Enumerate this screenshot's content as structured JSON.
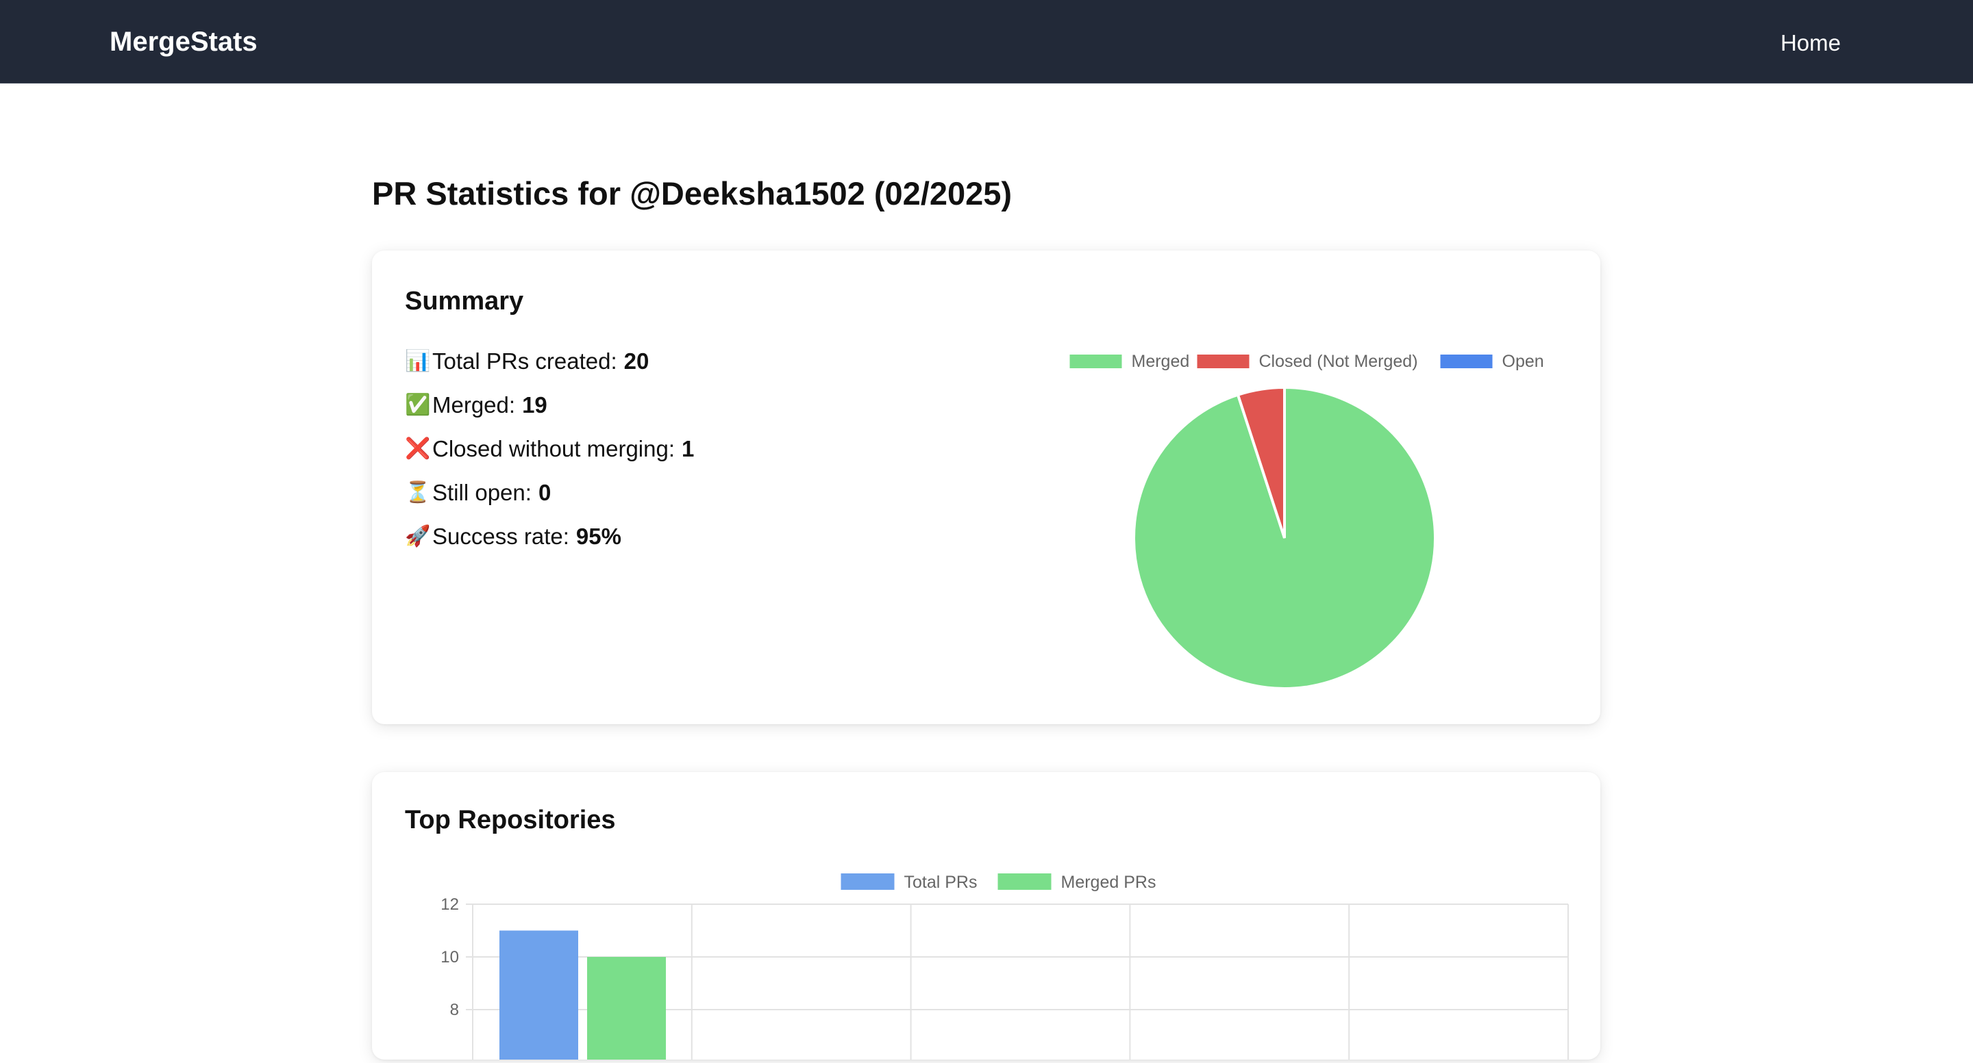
{
  "nav": {
    "brand": "MergeStats",
    "home": "Home"
  },
  "page": {
    "title": "PR Statistics for @Deeksha1502 (02/2025)"
  },
  "summary": {
    "title": "Summary",
    "stats": [
      {
        "icon": "bar-chart-icon",
        "emoji": "📊",
        "label": "Total PRs created:",
        "value": "20"
      },
      {
        "icon": "check-icon",
        "emoji": "✅",
        "label": "Merged:",
        "value": "19"
      },
      {
        "icon": "cross-icon",
        "emoji": "❌",
        "label": "Closed without merging:",
        "value": "1"
      },
      {
        "icon": "hourglass-icon",
        "emoji": "⏳",
        "label": "Still open:",
        "value": "0"
      },
      {
        "icon": "rocket-icon",
        "emoji": "🚀",
        "label": "Success rate:",
        "value": "95%"
      }
    ]
  },
  "repos": {
    "title": "Top Repositories"
  },
  "chart_data": [
    {
      "type": "pie",
      "legend_position": "top",
      "labels": [
        "Merged",
        "Closed (Not Merged)",
        "Open"
      ],
      "values": [
        19,
        1,
        0
      ],
      "colors": [
        "#7ade8a",
        "#e05550",
        "#4d86ec"
      ]
    },
    {
      "type": "bar",
      "legend_position": "top",
      "series": [
        {
          "name": "Total PRs",
          "color": "#6ea2ec",
          "values": [
            11
          ]
        },
        {
          "name": "Merged PRs",
          "color": "#7ade8a",
          "values": [
            10
          ]
        }
      ],
      "categories": [
        ""
      ],
      "ylim": [
        0,
        12
      ],
      "yticks": [
        "12",
        "10"
      ],
      "grid": true
    }
  ]
}
